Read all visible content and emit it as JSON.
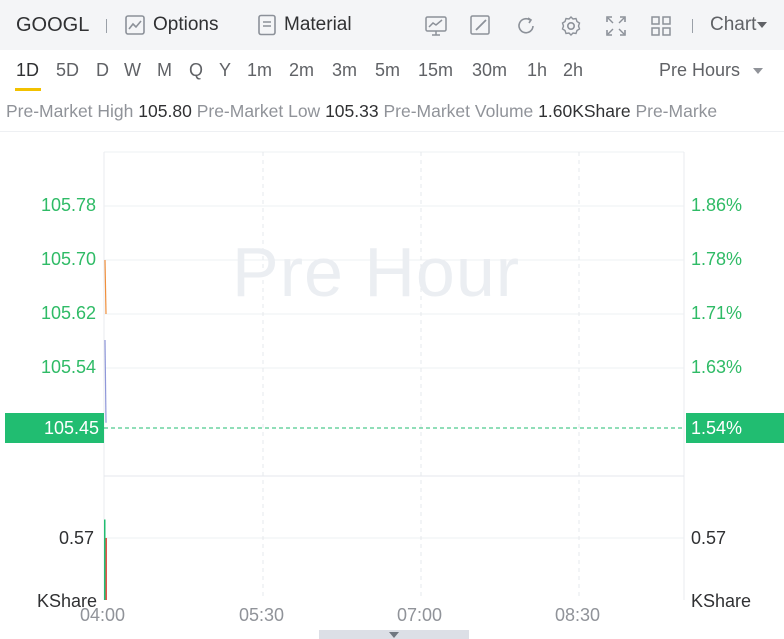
{
  "toolbar": {
    "ticker": "GOOGL",
    "options_label": "Options",
    "material_label": "Material",
    "chart_label": "Chart"
  },
  "periods": [
    "1D",
    "5D",
    "D",
    "W",
    "M",
    "Q",
    "Y",
    "1m",
    "2m",
    "3m",
    "5m",
    "15m",
    "30m",
    "1h",
    "2h"
  ],
  "active_period": "1D",
  "session_select": "Pre Hours",
  "stats": {
    "high_label": "Pre-Market High",
    "high_value": "105.80",
    "low_label": "Pre-Market Low",
    "low_value": "105.33",
    "volume_label": "Pre-Market Volume",
    "volume_value": "1.60KShare",
    "next_label": "Pre-Marke"
  },
  "watermark": "Pre Hour",
  "current": {
    "price": "105.45",
    "change_pct": "1.54%"
  },
  "colors": {
    "up": "#2fbb66",
    "current_bg": "#21bd71",
    "accent_underline": "#f2c100",
    "price_line_1": "#ef8f3c",
    "price_line_2": "#8f97d9"
  },
  "chart_data": {
    "type": "line",
    "x_ticks": [
      "04:00",
      "05:30",
      "07:00",
      "08:30"
    ],
    "price_axis": [
      "105.78",
      "105.70",
      "105.62",
      "105.54"
    ],
    "percent_axis": [
      "1.86%",
      "1.78%",
      "1.71%",
      "1.63%"
    ],
    "volume_axis": {
      "tick": "0.57",
      "unit": "KShare"
    },
    "series": [
      {
        "x": [
          "04:00",
          "04:00",
          "04:00"
        ],
        "values": [
          105.7,
          105.62,
          105.45
        ]
      }
    ],
    "volume": [
      {
        "x": "04:00",
        "value": 0.74,
        "color": "up"
      },
      {
        "x": "04:00",
        "value": 0.57,
        "color": "down"
      }
    ]
  }
}
